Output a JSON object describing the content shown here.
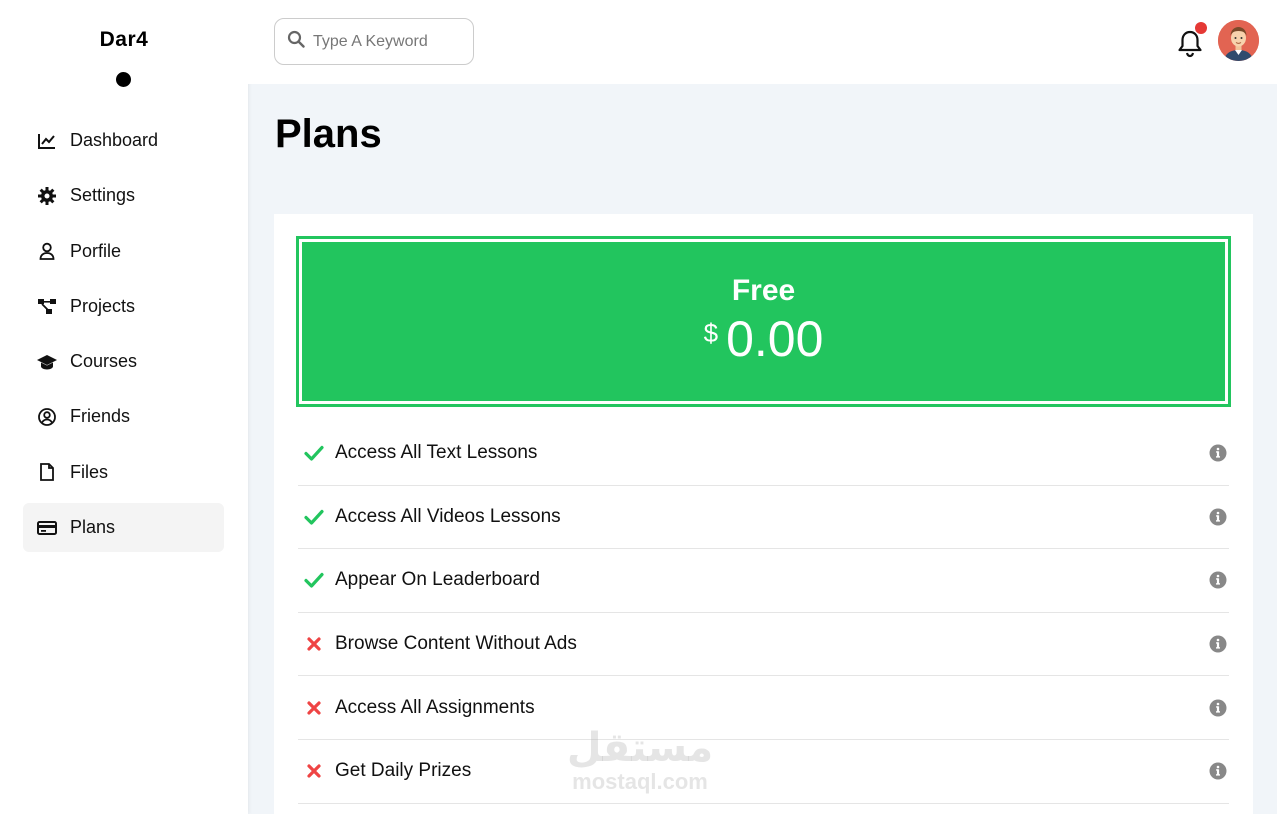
{
  "sidebar": {
    "brand": "Dar4",
    "items": [
      {
        "label": "Dashboard",
        "icon": "chart-line-icon",
        "active": false
      },
      {
        "label": "Settings",
        "icon": "gear-icon",
        "active": false
      },
      {
        "label": "Porfile",
        "icon": "user-icon",
        "active": false
      },
      {
        "label": "Projects",
        "icon": "diagram-project-icon",
        "active": false
      },
      {
        "label": "Courses",
        "icon": "graduation-cap-icon",
        "active": false
      },
      {
        "label": "Friends",
        "icon": "circle-user-icon",
        "active": false
      },
      {
        "label": "Files",
        "icon": "file-icon",
        "active": false
      },
      {
        "label": "Plans",
        "icon": "credit-card-icon",
        "active": true
      }
    ]
  },
  "header": {
    "search_placeholder": "Type A Keyword",
    "has_notification": true
  },
  "main": {
    "title": "Plans",
    "plan": {
      "name": "Free",
      "currency": "$",
      "price": "0.00",
      "color": "#22c55e",
      "features": [
        {
          "label": "Access All Text Lessons",
          "included": true
        },
        {
          "label": "Access All Videos Lessons",
          "included": true
        },
        {
          "label": "Appear On Leaderboard",
          "included": true
        },
        {
          "label": "Browse Content Without Ads",
          "included": false
        },
        {
          "label": "Access All Assignments",
          "included": false
        },
        {
          "label": "Get Daily Prizes",
          "included": false
        }
      ]
    }
  },
  "colors": {
    "check": "#22c55e",
    "cross": "#ef4444",
    "info": "#888888",
    "notification": "#e53935"
  },
  "watermark": {
    "arabic": "مستقل",
    "latin": "mostaql.com"
  }
}
